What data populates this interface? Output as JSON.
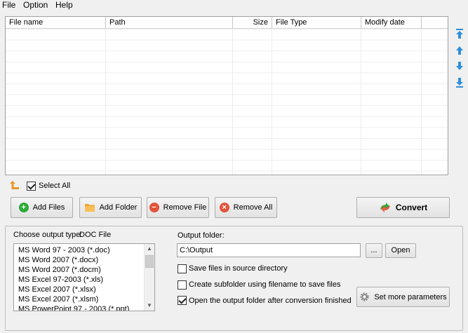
{
  "menu": {
    "file": "File",
    "option": "Option",
    "help": "Help"
  },
  "file_list": {
    "columns": [
      "File name",
      "Path",
      "Size",
      "File Type",
      "Modify date"
    ],
    "rows": []
  },
  "select_all": {
    "label": "Select All",
    "checked": true
  },
  "buttons": {
    "add_files": "Add Files",
    "add_folder": "Add Folder",
    "remove_file": "Remove File",
    "remove_all": "Remove All",
    "convert": "Convert",
    "browse": "...",
    "open": "Open",
    "more_params": "Set more parameters"
  },
  "output_type": {
    "label": "Choose output type:",
    "selected": "DOC File",
    "options": [
      "MS Word 97 - 2003 (*.doc)",
      "MS Word 2007 (*.docx)",
      "MS Word 2007 (*.docm)",
      "MS Excel 97-2003 (*.xls)",
      "MS Excel 2007 (*.xlsx)",
      "MS Excel 2007 (*.xlsm)",
      "MS PowerPoint 97 - 2003 (*.ppt)"
    ]
  },
  "output_folder": {
    "label": "Output folder:",
    "value": "C:\\Output"
  },
  "options": {
    "save_in_source": {
      "label": "Save files in source directory",
      "checked": false
    },
    "create_subfolder": {
      "label": "Create subfolder using filename to save files",
      "checked": false
    },
    "open_after": {
      "label": "Open the output folder after conversion finished",
      "checked": true
    }
  },
  "colors": {
    "add_green": "#2eaa3a",
    "remove_red": "#e0533a",
    "folder_orange": "#f0a430",
    "arrow_blue": "#2f8fd8",
    "up_arrow_orange": "#e8972a"
  }
}
